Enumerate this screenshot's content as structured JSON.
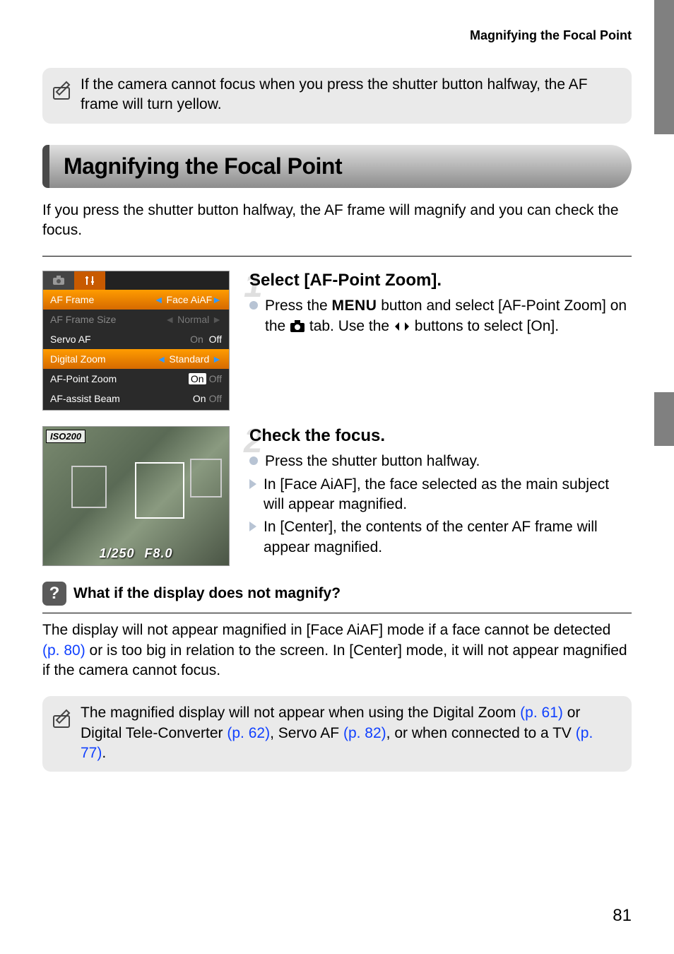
{
  "header": {
    "breadcrumb": "Magnifying the Focal Point"
  },
  "note1": {
    "text": "If the camera cannot focus when you press the shutter button halfway, the AF frame will turn yellow."
  },
  "section": {
    "title": "Magnifying the Focal Point"
  },
  "intro": {
    "text": "If you press the shutter button halfway, the AF frame will magnify and you can check the focus."
  },
  "menu": {
    "rows": [
      {
        "label": "AF Frame",
        "value": "Face AiAF"
      },
      {
        "label": "AF Frame Size",
        "value": "Normal"
      },
      {
        "label": "Servo AF",
        "value_on": "On",
        "value_off": "Off"
      },
      {
        "label": "Digital Zoom",
        "value": "Standard"
      },
      {
        "label": "AF-Point Zoom",
        "value_on": "On",
        "value_off": "Off"
      },
      {
        "label": "AF-assist Beam",
        "value_on": "On",
        "value_off": "Off"
      }
    ]
  },
  "photo": {
    "iso": "ISO200",
    "shutter": "1/250",
    "aperture": "F8.0"
  },
  "step1": {
    "num": "1",
    "title": "Select [AF-Point Zoom].",
    "body_pre": "Press the ",
    "menu_word": "MENU",
    "body_mid": " button and select [AF-Point Zoom] on the ",
    "body_post": " tab. Use the ",
    "body_end": " buttons to select [On]."
  },
  "step2": {
    "num": "2",
    "title": "Check the focus.",
    "bullet1": "Press the shutter button halfway.",
    "bullet2": "In [Face AiAF], the face selected as the main subject will appear magnified.",
    "bullet3": "In [Center], the contents of the center AF frame will appear magnified."
  },
  "qa": {
    "title": "What if the display does not magnify?",
    "body_pre": "The display will not appear magnified in [Face AiAF] mode if a face cannot be detected ",
    "link1": "(p. 80)",
    "body_post": " or is too big in relation to the screen. In [Center] mode, it will not appear magnified if the camera cannot focus."
  },
  "note2": {
    "pre": "The magnified display will not appear when using the Digital Zoom ",
    "l1": "(p. 61)",
    "m1": " or Digital Tele-Converter ",
    "l2": "(p. 62)",
    "m2": ", Servo AF ",
    "l3": "(p. 82)",
    "m3": ", or when connected to a TV ",
    "l4": "(p. 77)",
    "end": "."
  },
  "page_number": "81"
}
